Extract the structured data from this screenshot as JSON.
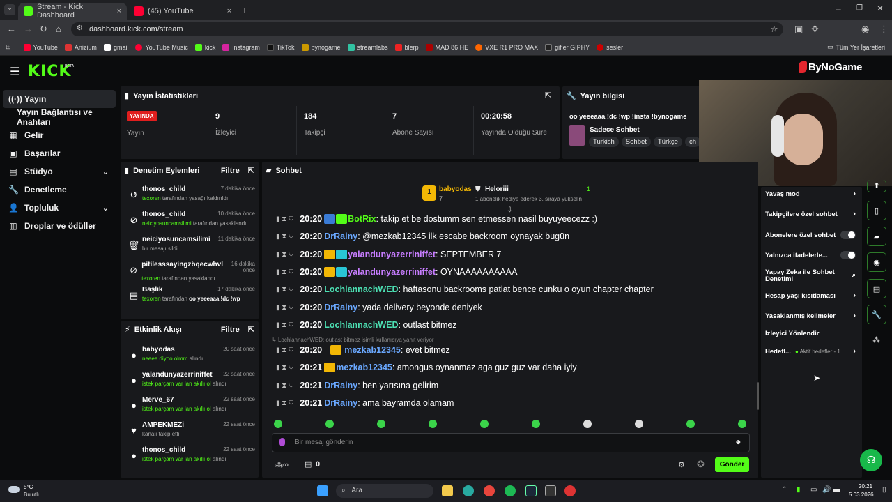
{
  "browser": {
    "tabs": [
      {
        "title": "Stream - Kick Dashboard",
        "close": "×"
      },
      {
        "title": "(45) YouTube",
        "close": "×"
      }
    ],
    "new_tab": "+",
    "url": "dashboard.kick.com/stream",
    "bookmarks": [
      "YouTube",
      "Anizium",
      "gmail",
      "YouTube Music",
      "kick",
      "instagram",
      "TikTok",
      "bynogame",
      "streamlabs",
      "blerp",
      "MAD 86 HE",
      "VXE R1 PRO MAX",
      "gifler GIPHY",
      "sesler"
    ],
    "all_bookmarks": "Tüm Yer İşaretleri"
  },
  "brand": {
    "logo": "KICK",
    "beta": "BETA",
    "sponsor": "ByNoGame"
  },
  "sidebar": {
    "items": [
      {
        "label": "Yayın",
        "icon": "((·))"
      },
      {
        "label": "Yayın Bağlantısı ve Anahtarı",
        "icon": ""
      },
      {
        "label": "Gelir",
        "icon": "▦"
      },
      {
        "label": "Başarılar",
        "icon": "▣"
      },
      {
        "label": "Stüdyo",
        "icon": "▤"
      },
      {
        "label": "Denetleme",
        "icon": "🔧"
      },
      {
        "label": "Topluluk",
        "icon": "👤"
      },
      {
        "label": "Droplar ve ödüller",
        "icon": "▥"
      }
    ]
  },
  "stats": {
    "title": "Yayın İstatistikleri",
    "live_badge": "YAYINDA",
    "live_label": "Yayın",
    "items": [
      {
        "value": "9",
        "label": "İzleyici"
      },
      {
        "value": "184",
        "label": "Takipçi"
      },
      {
        "value": "7",
        "label": "Abone Sayısı"
      },
      {
        "value": "00:20:58",
        "label": "Yayında Olduğu Süre"
      }
    ]
  },
  "info": {
    "title": "Yayın bilgisi",
    "stream_title": "oo yeeeaaa !dc !wp !insta !bynogame",
    "category": "Sadece Sohbet",
    "tags": [
      "Turkish",
      "Sohbet",
      "Türkçe",
      "ch"
    ]
  },
  "moderation": {
    "title": "Denetim Eylemleri",
    "filter": "Filtre",
    "items": [
      {
        "icon": "↺",
        "name": "thonos_child",
        "time": "7 dakika önce",
        "actor": "texoren",
        "desc": " tarafından yasağı kaldırıldı",
        "extra": ""
      },
      {
        "icon": "⊘",
        "name": "thonos_child",
        "time": "10 dakika önce",
        "actor": "neiciyosuncamsilimi",
        "desc": " tarafından yasaklandı",
        "extra": ""
      },
      {
        "icon": "🗑",
        "name": "neiciyosuncamsilimi",
        "time": "11 dakika önce",
        "actor": "",
        "desc": "bir mesajı sildi",
        "extra": ""
      },
      {
        "icon": "⊘",
        "name": "pitilesssayingzbqecwhvl",
        "time": "16 dakika önce",
        "actor": "texoren",
        "desc": " tarafından yasaklandı",
        "extra": ""
      },
      {
        "icon": "▤",
        "name": "Başlık",
        "time": "17 dakika önce",
        "actor": "texoren",
        "desc": " tarafından ",
        "extra": "oo yeeeaaa !dc !wp"
      }
    ]
  },
  "activity": {
    "title": "Etkinlik Akışı",
    "filter": "Filtre",
    "items": [
      {
        "icon": "●",
        "name": "babyodas",
        "time": "20 saat önce",
        "reward": "neeee diyoo olmm",
        "suffix": " alındı"
      },
      {
        "icon": "●",
        "name": "yalandunyazerriniffet",
        "time": "22 saat önce",
        "reward": "istek parçam var lan akıllı ol",
        "suffix": " alındı"
      },
      {
        "icon": "●",
        "name": "Merve_67",
        "time": "22 saat önce",
        "reward": "istek parçam var lan akıllı ol",
        "suffix": " alındı"
      },
      {
        "icon": "♥",
        "name": "AMPEKMEZi",
        "time": "22 saat önce",
        "reward": "",
        "suffix": "kanalı takip etti"
      },
      {
        "icon": "●",
        "name": "thonos_child",
        "time": "22 saat önce",
        "reward": "istek parçam var lan akıllı ol",
        "suffix": " alındı"
      }
    ]
  },
  "chat": {
    "title": "Sohbet",
    "pinned": {
      "rank": "1",
      "name": "babyodas",
      "count": "7",
      "gifter": "Heloriii",
      "gifter_count": "1",
      "gift_text": "1 abonelik hediye ederek 3. sıraya yükselin"
    },
    "reply_hint": "LochlannachWED: outlast bitmez isimli kullanıcıya yanıt veriyor",
    "messages": [
      {
        "time": "20:20",
        "user": "BotRix",
        "color": "#53fc18",
        "text": ": takip et be dostumm sen etmessen nasil buyuyeecezz :)"
      },
      {
        "time": "20:20",
        "user": "DrRainy",
        "color": "#6aa8ff",
        "text": ": @mezkab12345 ilk escabe backroom oynayak bugün"
      },
      {
        "time": "20:20",
        "user": "yalandunyazerriniffet",
        "color": "#c77dff",
        "text": ": SEPTEMBER 7"
      },
      {
        "time": "20:20",
        "user": "yalandunyazerriniffet",
        "color": "#c77dff",
        "text": ": OYNAAAAAAAAAA"
      },
      {
        "time": "20:20",
        "user": "LochlannachWED",
        "color": "#4ce0b3",
        "text": ": haftasonu backrooms patlat bence cunku o oyun chapter chapter"
      },
      {
        "time": "20:20",
        "user": "DrRainy",
        "color": "#6aa8ff",
        "text": ": yada delivery beyonde deniyek"
      },
      {
        "time": "20:20",
        "user": "LochlannachWED",
        "color": "#4ce0b3",
        "text": ": outlast bitmez"
      },
      {
        "time": "20:20",
        "user": "mezkab12345",
        "color": "#6aa8ff",
        "text": ": evet bitmez"
      },
      {
        "time": "20:21",
        "user": "mezkab12345",
        "color": "#6aa8ff",
        "text": ": amongus oynanmaz aga guz guz var daha iyiy"
      },
      {
        "time": "20:21",
        "user": "DrRainy",
        "color": "#6aa8ff",
        "text": ": ben yarısına gelirim"
      },
      {
        "time": "20:21",
        "user": "DrRainy",
        "color": "#6aa8ff",
        "text": ": ama bayramda olamam"
      }
    ],
    "input_placeholder": "Bir mesaj gönderin",
    "points": "0",
    "send": "Gönder"
  },
  "chat_settings": {
    "items": [
      {
        "label": "Yavaş mod",
        "type": "arrow"
      },
      {
        "label": "Takipçilere özel sohbet",
        "type": "arrow"
      },
      {
        "label": "Abonelere özel sohbet",
        "type": "toggle"
      },
      {
        "label": "Yalnızca ifadelerle...",
        "type": "toggle"
      },
      {
        "label": "Yapay Zeka ile Sohbet Denetimi",
        "type": "link"
      },
      {
        "label": "Hesap yaşı kısıtlaması",
        "type": "arrow"
      },
      {
        "label": "Yasaklanmış kelimeler",
        "type": "arrow"
      },
      {
        "label": "İzleyici Yönlendir",
        "type": "none"
      },
      {
        "label": "Hedefl...",
        "type": "arrow"
      }
    ],
    "goals_status": "Aktif hedefler - 1"
  },
  "taskbar": {
    "weather_temp": "5°C",
    "weather_desc": "Bulutlu",
    "search": "Ara",
    "time": "20:21",
    "date": "5.03.2026"
  },
  "colors": {
    "accent": "#53fc18",
    "panel": "#18191c",
    "bg": "#0b0c0d"
  }
}
